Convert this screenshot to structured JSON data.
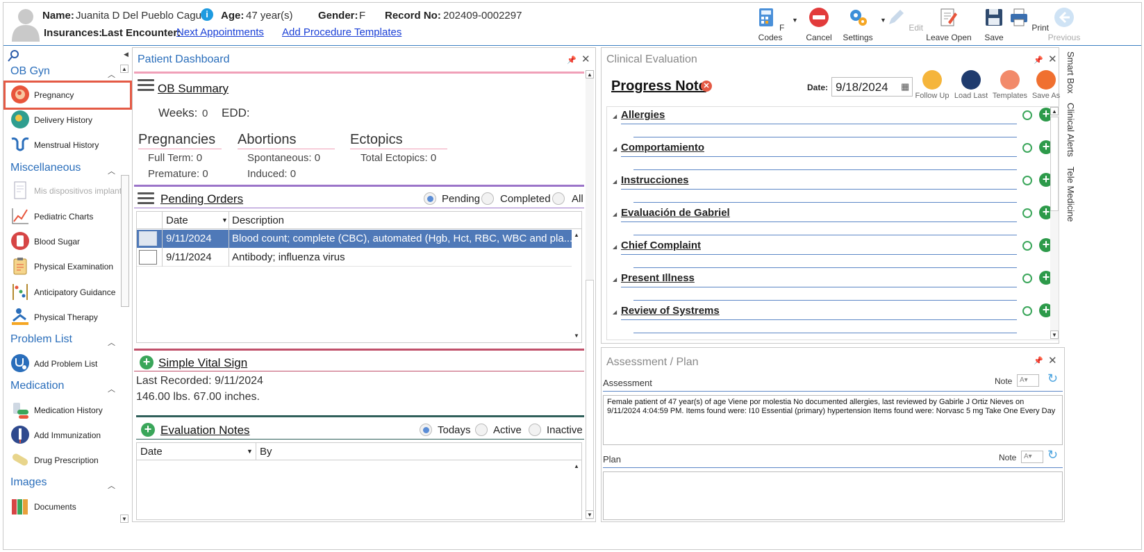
{
  "header": {
    "name_label": "Name:",
    "name_value": "Juanita D Del Pueblo Caguas",
    "age_label": "Age:",
    "age_value": "47 year(s)",
    "gender_label": "Gender:",
    "gender_value": "F",
    "record_label": "Record No:",
    "record_value": "202409-0002297",
    "insurances_label": "Insurances:",
    "last_encounter_label": "Last Encounter:",
    "next_appointments": "Next Appointments",
    "add_procedure_templates": "Add Procedure Templates"
  },
  "toolbar": {
    "fcodes": "F Codes",
    "cancel": "Cancel",
    "settings": "Settings",
    "edit": "Edit",
    "leave_open": "Leave Open",
    "save": "Save",
    "print": "Print",
    "previous": "Previous"
  },
  "sidebar": {
    "sections": [
      {
        "title": "OB Gyn",
        "items": [
          "Pregnancy",
          "Delivery History",
          "Menstrual History"
        ]
      },
      {
        "title": "Miscellaneous",
        "items": [
          "Mis dispositivos implanta",
          "Pediatric Charts",
          "Blood Sugar",
          "Physical Examination",
          "Anticipatory Guidance",
          "Physical Therapy"
        ]
      },
      {
        "title": "Problem List",
        "items": [
          "Add Problem List"
        ]
      },
      {
        "title": "Medication",
        "items": [
          "Medication History",
          "Add Immunization",
          "Drug Prescription"
        ]
      },
      {
        "title": "Images",
        "items": [
          "Documents"
        ]
      }
    ]
  },
  "dashboard": {
    "title": "Patient Dashboard",
    "ob_summary": "OB Summary",
    "weeks_label": "Weeks:",
    "weeks_value": "0",
    "edd_label": "EDD:",
    "pregnancies": "Pregnancies",
    "full_term": "Full Term: 0",
    "premature": "Premature: 0",
    "abortions": "Abortions",
    "spontaneous": "Spontaneous: 0",
    "induced": "Induced: 0",
    "ectopics": "Ectopics",
    "total_ectopics": "Total Ectopics: 0",
    "pending_orders": "Pending Orders",
    "radio_pending": "Pending",
    "radio_completed": "Completed",
    "radio_all": "All",
    "col_date": "Date",
    "col_description": "Description",
    "orders": [
      {
        "date": "9/11/2024",
        "description": "Blood count; complete (CBC), automated (Hgb, Hct, RBC, WBC and pla..."
      },
      {
        "date": "9/11/2024",
        "description": "Antibody; influenza virus"
      }
    ],
    "simple_vital_sign": "Simple Vital Sign",
    "last_recorded": "Last Recorded: 9/11/2024",
    "vitals": "146.00 lbs. 67.00 inches.",
    "evaluation_notes": "Evaluation Notes",
    "radio_todays": "Todays",
    "radio_active": "Active",
    "radio_inactive": "Inactive",
    "eval_col_date": "Date",
    "eval_col_by": "By"
  },
  "clinical": {
    "title": "Clinical Evaluation",
    "progress_note": "Progress Note",
    "date_label": "Date:",
    "date_value": "9/18/2024",
    "buttons": [
      "Follow Up",
      "Load Last",
      "Templates",
      "Save As"
    ],
    "categories": [
      "Allergies",
      "Comportamiento",
      "Instrucciones",
      "Evaluación de Gabriel",
      "Chief Complaint",
      "Present Illness",
      "Review of Systrems"
    ]
  },
  "assessment": {
    "title": "Assessment / Plan",
    "assessment_label": "Assessment",
    "note_label": "Note",
    "assessment_text": "Female patient of 47 year(s) of age Viene por molestia     No documented allergies, last reviewed by Gabirle J Ortiz Nieves on 9/11/2024 4:04:59 PM.     Items found were:  I10 Essential (primary) hypertension  Items found were:  Norvasc 5 mg Take One Every Day",
    "plan_label": "Plan"
  },
  "side_tabs": [
    "Smart Box",
    "Clinical Alerts",
    "Tele Medicine"
  ],
  "colors": {
    "accent": "#2a6ebb",
    "highlight_row": "#4f79b8",
    "pink_line": "#f0a0b8",
    "purple_line": "#9b74c9",
    "red_line": "#c0506a",
    "teal_line": "#2f5f5a"
  }
}
